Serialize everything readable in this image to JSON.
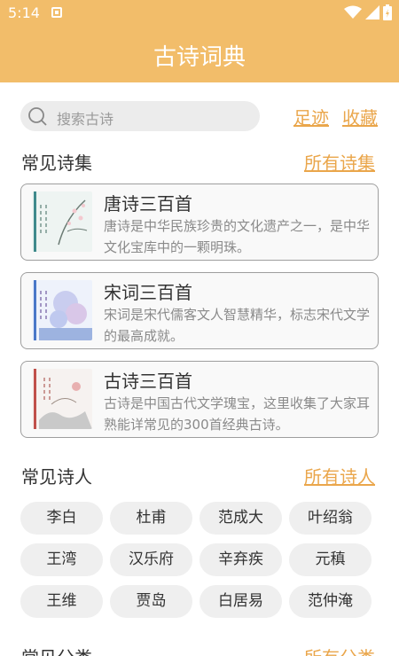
{
  "colors": {
    "header": "#f2bd6a",
    "accent": "#eaa64b"
  },
  "status_bar": {
    "time": "5:14",
    "icons": [
      "notification-icon",
      "wifi-icon",
      "signal-icon",
      "battery-icon"
    ]
  },
  "header": {
    "title": "古诗词典"
  },
  "search": {
    "placeholder": "搜索古诗"
  },
  "top_links": {
    "history": "足迹",
    "favorites": "收藏"
  },
  "anthologies": {
    "title": "常见诗集",
    "all_link": "所有诗集",
    "items": [
      {
        "name": "唐诗三百首",
        "desc": "唐诗是中华民族珍贵的文化遗产之一，是中华文化宝库中的一颗明珠。",
        "cover": "tang-poems-cover"
      },
      {
        "name": "宋词三百首",
        "desc": "宋词是宋代儒客文人智慧精华，标志宋代文学的最高成就。",
        "cover": "song-ci-cover"
      },
      {
        "name": "古诗三百首",
        "desc": "古诗是中国古代文学瑰宝，这里收集了大家耳熟能详常见的300首经典古诗。",
        "cover": "ancient-poems-cover"
      }
    ]
  },
  "poets": {
    "title": "常见诗人",
    "all_link": "所有诗人",
    "items": [
      "李白",
      "杜甫",
      "范成大",
      "叶绍翁",
      "王湾",
      "汉乐府",
      "辛弃疾",
      "元稹",
      "王维",
      "贾岛",
      "白居易",
      "范仲淹"
    ]
  },
  "categories": {
    "title": "常见分类",
    "all_link": "所有分类"
  }
}
